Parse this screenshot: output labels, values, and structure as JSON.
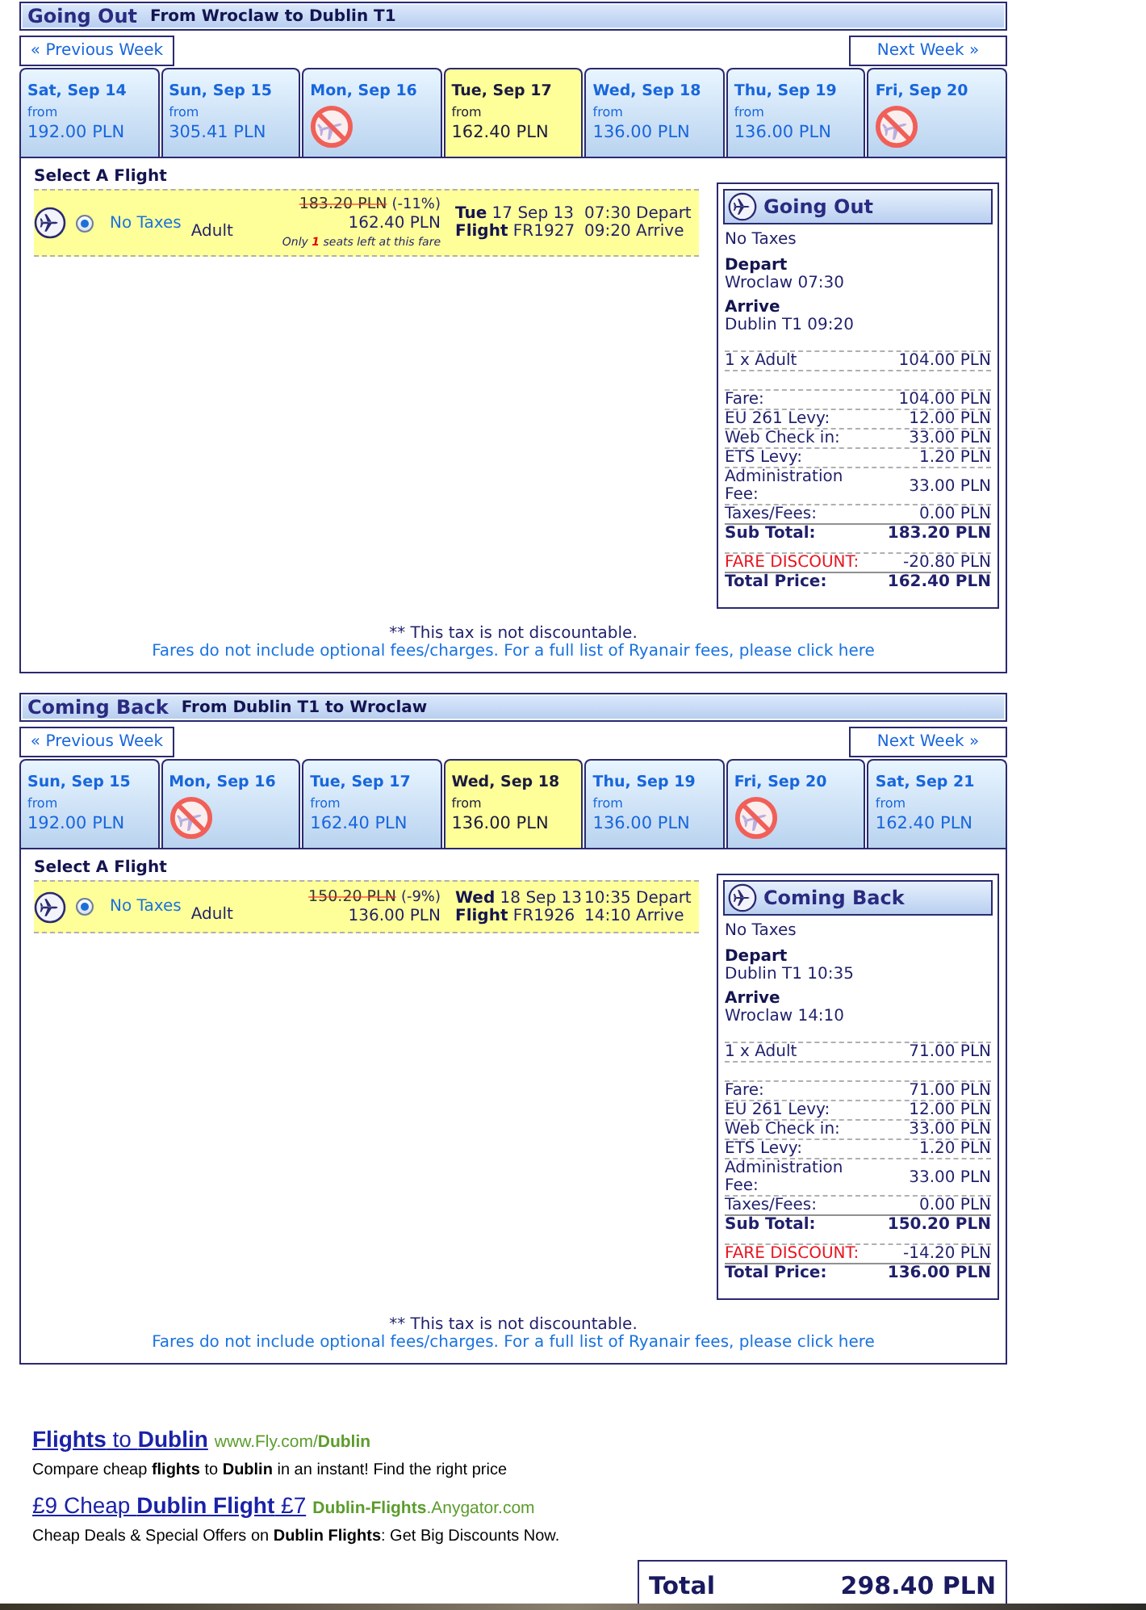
{
  "sections": [
    {
      "title": "Going Out",
      "route": "From Wroclaw to Dublin T1",
      "prev_week": "« Previous Week",
      "next_week": "Next Week »",
      "days": [
        {
          "date": "Sat, Sep 14",
          "from": "from",
          "price": "192.00 PLN",
          "available": true,
          "selected": false
        },
        {
          "date": "Sun, Sep 15",
          "from": "from",
          "price": "305.41 PLN",
          "available": true,
          "selected": false
        },
        {
          "date": "Mon, Sep 16",
          "available": false,
          "selected": false
        },
        {
          "date": "Tue, Sep 17",
          "from": "from",
          "price": "162.40 PLN",
          "available": true,
          "selected": true
        },
        {
          "date": "Wed, Sep 18",
          "from": "from",
          "price": "136.00 PLN",
          "available": true,
          "selected": false
        },
        {
          "date": "Thu, Sep 19",
          "from": "from",
          "price": "136.00 PLN",
          "available": true,
          "selected": false
        },
        {
          "date": "Fri, Sep 20",
          "available": false,
          "selected": false
        }
      ],
      "select_heading": "Select A Flight",
      "flight": {
        "selected": true,
        "fare_type": "No Taxes",
        "passenger": "Adult",
        "old_price": "183.20 PLN",
        "discount": "(-11%)",
        "price": "162.40 PLN",
        "seats_note": "Only **1** seats left at this fare",
        "date_line": "**Tue** 17 Sep 13",
        "flight_line": "**Flight** FR1927",
        "depart": "07:30 Depart",
        "arrive": "09:20 Arrive"
      },
      "summary": {
        "title": "Going Out",
        "fare_type": "No Taxes",
        "depart_label": "Depart",
        "depart_value": "Wroclaw 07:30",
        "arrive_label": "Arrive",
        "arrive_value": "Dublin T1 09:20",
        "lines": [
          {
            "kind": "passenger",
            "label": "1 x Adult",
            "value": "104.00 PLN"
          },
          {
            "kind": "fee",
            "label": "Fare:",
            "value": "104.00 PLN"
          },
          {
            "kind": "fee",
            "label": "EU 261 Levy:",
            "value": "12.00 PLN"
          },
          {
            "kind": "fee",
            "label": "Web Check in:",
            "value": "33.00 PLN"
          },
          {
            "kind": "fee",
            "label": "ETS Levy:",
            "value": "1.20 PLN"
          },
          {
            "kind": "fee",
            "label": "Administration Fee:",
            "value": "33.00 PLN"
          },
          {
            "kind": "fee",
            "label": "Taxes/Fees:",
            "value": "0.00 PLN"
          },
          {
            "kind": "subtotal",
            "label": "Sub Total:",
            "value": "183.20 PLN"
          },
          {
            "kind": "discount",
            "label": "FARE DISCOUNT:",
            "value": "-20.80 PLN"
          },
          {
            "kind": "total",
            "label": "Total Price:",
            "value": "162.40 PLN"
          }
        ]
      },
      "footnote": "** This tax is not discountable.",
      "fees_link": "Fares do not include optional fees/charges. For a full list of Ryanair fees, please click here"
    },
    {
      "title": "Coming Back",
      "route": "From Dublin T1 to Wroclaw",
      "prev_week": "« Previous Week",
      "next_week": "Next Week »",
      "days": [
        {
          "date": "Sun, Sep 15",
          "from": "from",
          "price": "192.00 PLN",
          "available": true,
          "selected": false
        },
        {
          "date": "Mon, Sep 16",
          "available": false,
          "selected": false
        },
        {
          "date": "Tue, Sep 17",
          "from": "from",
          "price": "162.40 PLN",
          "available": true,
          "selected": false
        },
        {
          "date": "Wed, Sep 18",
          "from": "from",
          "price": "136.00 PLN",
          "available": true,
          "selected": true
        },
        {
          "date": "Thu, Sep 19",
          "from": "from",
          "price": "136.00 PLN",
          "available": true,
          "selected": false
        },
        {
          "date": "Fri, Sep 20",
          "available": false,
          "selected": false
        },
        {
          "date": "Sat, Sep 21",
          "from": "from",
          "price": "162.40 PLN",
          "available": true,
          "selected": false
        }
      ],
      "select_heading": "Select A Flight",
      "flight": {
        "selected": true,
        "fare_type": "No Taxes",
        "passenger": "Adult",
        "old_price": "150.20 PLN",
        "discount": "(-9%)",
        "price": "136.00 PLN",
        "date_line": "**Wed** 18 Sep 13",
        "flight_line": "**Flight** FR1926",
        "depart": "10:35 Depart",
        "arrive": "14:10 Arrive"
      },
      "summary": {
        "title": "Coming Back",
        "fare_type": "No Taxes",
        "depart_label": "Depart",
        "depart_value": "Dublin T1 10:35",
        "arrive_label": "Arrive",
        "arrive_value": "Wroclaw 14:10",
        "lines": [
          {
            "kind": "passenger",
            "label": "1 x Adult",
            "value": "71.00 PLN"
          },
          {
            "kind": "fee",
            "label": "Fare:",
            "value": "71.00 PLN"
          },
          {
            "kind": "fee",
            "label": "EU 261 Levy:",
            "value": "12.00 PLN"
          },
          {
            "kind": "fee",
            "label": "Web Check in:",
            "value": "33.00 PLN"
          },
          {
            "kind": "fee",
            "label": "ETS Levy:",
            "value": "1.20 PLN"
          },
          {
            "kind": "fee",
            "label": "Administration Fee:",
            "value": "33.00 PLN"
          },
          {
            "kind": "fee",
            "label": "Taxes/Fees:",
            "value": "0.00 PLN"
          },
          {
            "kind": "subtotal",
            "label": "Sub Total:",
            "value": "150.20 PLN"
          },
          {
            "kind": "discount",
            "label": "FARE DISCOUNT:",
            "value": "-14.20 PLN"
          },
          {
            "kind": "total",
            "label": "Total Price:",
            "value": "136.00 PLN"
          }
        ]
      },
      "footnote": "** This tax is not discountable.",
      "fees_link": "Fares do not include optional fees/charges. For a full list of Ryanair fees, please click here"
    }
  ],
  "ads": [
    {
      "title": "**Flights** to **Dublin**",
      "url": "www.Fly.com/**Dublin**",
      "description": "Compare cheap **flights** to **Dublin** in an instant! Find the right price"
    },
    {
      "title": "£9 Cheap **Dublin Flight** £7",
      "url": "**Dublin-Flights**.Anygator.com",
      "description": "Cheap Deals & Special Offers on **Dublin Flights**: Get Big Discounts Now."
    }
  ],
  "total": {
    "label": "Total",
    "value": "298.40 PLN"
  }
}
